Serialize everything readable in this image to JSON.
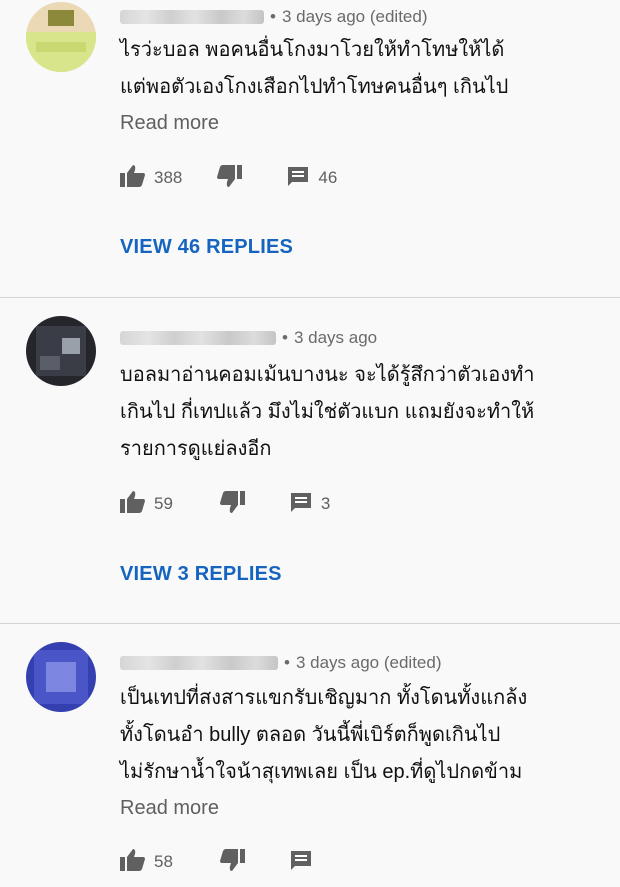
{
  "comments": [
    {
      "time": "3 days ago (edited)",
      "text": "ไรว่ะบอล พอคนอื่นโกงมาโวยให้ทำโทษให้ได้\nแต่พอตัวเองโกงเสือกไปทำโทษคนอื่นๆ เกินไป",
      "read_more": "Read more",
      "likes": "388",
      "replies_count": "46",
      "view_replies": "VIEW 46 REPLIES",
      "avatar_colors": [
        "#d9e58a",
        "#8c8a3a",
        "#ead9b4"
      ]
    },
    {
      "time": "3 days ago",
      "text": "บอลมาอ่านคอมเม้นบางนะ จะได้รู้สึกว่าตัวเองทำ\nเกินไป กี่เทปแล้ว มึงไม่ใช่ตัวแบก แถมยังจะทำให้\nรายการดูแย่ลงอีก",
      "likes": "59",
      "replies_count": "3",
      "view_replies": "VIEW 3 REPLIES",
      "avatar_colors": [
        "#3b3d46",
        "#9aa0aa",
        "#24262c"
      ]
    },
    {
      "time": "3 days ago (edited)",
      "text": "เป็นเทปที่สงสารแขกรับเชิญมาก ทั้งโดนทั้งแกล้ง\nทั้งโดนอำ bully ตลอด วันนี้พี่เบิร์ตก็พูดเกินไป\nไม่รักษาน้ำใจน้าสุเทพเลย เป็น ep.ที่ดูไปกดข้าม",
      "read_more": "Read more",
      "likes": "58",
      "avatar_colors": [
        "#4a55c8",
        "#7d86e0",
        "#3440b0"
      ]
    }
  ],
  "colors": {
    "link": "#1565c0",
    "meta": "#6a6a6a",
    "icon": "#606060",
    "divider": "#d4d4d4",
    "background": "#f9f9f9"
  },
  "icons": {
    "like": "thumb-up-icon",
    "dislike": "thumb-down-icon",
    "reply": "comment-icon"
  }
}
